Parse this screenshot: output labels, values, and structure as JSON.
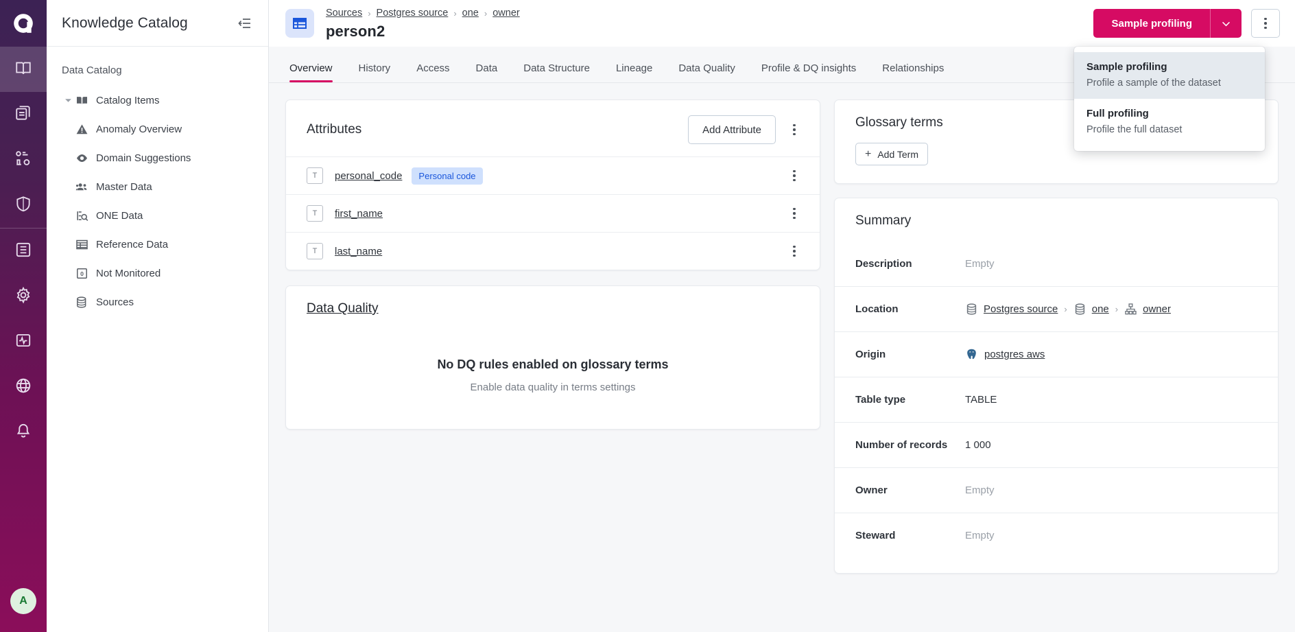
{
  "brand": {
    "logo_alt": "ataccama-logo",
    "accent": "#d60b63",
    "rail_gradient_top": "#3c2254",
    "rail_gradient_bottom": "#8b0e5a"
  },
  "rail": {
    "items": [
      {
        "name": "knowledge-catalog",
        "icon": "book-icon",
        "active": true
      },
      {
        "name": "files",
        "icon": "documents-icon",
        "active": false
      },
      {
        "name": "data-observability",
        "icon": "metrics-icon",
        "active": false
      },
      {
        "name": "data-privacy",
        "icon": "shield-icon",
        "active": false
      },
      {
        "name": "tasks",
        "icon": "list-icon",
        "active": false
      },
      {
        "name": "settings",
        "icon": "gear-icon",
        "active": false
      },
      {
        "name": "monitoring",
        "icon": "pulse-icon",
        "active": false
      },
      {
        "name": "global",
        "icon": "globe-icon",
        "active": false
      },
      {
        "name": "notifications",
        "icon": "bell-icon",
        "active": false
      }
    ],
    "avatar_initial": "A"
  },
  "sidebar": {
    "title": "Knowledge Catalog",
    "collapse_icon": "collapse-panel-icon",
    "section_label": "Data Catalog",
    "tree": [
      {
        "label": "Catalog Items",
        "icon": "book-icon",
        "level": 1,
        "expanded": true
      },
      {
        "label": "Anomaly Overview",
        "icon": "warning-triangle-icon",
        "level": 2
      },
      {
        "label": "Domain Suggestions",
        "icon": "eye-icon",
        "level": 2
      },
      {
        "label": "Master Data",
        "icon": "people-icon",
        "level": 2
      },
      {
        "label": "ONE Data",
        "icon": "search-data-icon",
        "level": 2
      },
      {
        "label": "Reference Data",
        "icon": "table-icon",
        "level": 2
      },
      {
        "label": "Not Monitored",
        "icon": "zero-box-icon",
        "level": 2
      },
      {
        "label": "Sources",
        "icon": "database-icon",
        "level": 1
      }
    ]
  },
  "header": {
    "entity_icon": "table-icon",
    "breadcrumbs": [
      "Sources",
      "Postgres source",
      "one",
      "owner"
    ],
    "breadcrumb_separator": "›",
    "title": "person2",
    "primary_button": "Sample profiling",
    "caret_icon": "chevron-down-icon",
    "kebab_icon": "more-vertical-icon"
  },
  "dropdown": {
    "items": [
      {
        "title": "Sample profiling",
        "desc": "Profile a sample of the dataset",
        "hovered": true
      },
      {
        "title": "Full profiling",
        "desc": "Profile the full dataset",
        "hovered": false
      }
    ]
  },
  "tabs": [
    {
      "label": "Overview",
      "active": true
    },
    {
      "label": "History",
      "active": false
    },
    {
      "label": "Access",
      "active": false
    },
    {
      "label": "Data",
      "active": false
    },
    {
      "label": "Data Structure",
      "active": false
    },
    {
      "label": "Lineage",
      "active": false
    },
    {
      "label": "Data Quality",
      "active": false
    },
    {
      "label": "Profile & DQ insights",
      "active": false
    },
    {
      "label": "Relationships",
      "active": false
    }
  ],
  "attributes_card": {
    "title": "Attributes",
    "add_button": "Add Attribute",
    "kebab_icon": "more-vertical-icon",
    "rows": [
      {
        "type_glyph": "T",
        "name": "personal_code",
        "badge": "Personal code"
      },
      {
        "type_glyph": "T",
        "name": "first_name",
        "badge": ""
      },
      {
        "type_glyph": "T",
        "name": "last_name",
        "badge": ""
      }
    ]
  },
  "data_quality_card": {
    "title": "Data Quality",
    "empty_title": "No DQ rules enabled on glossary terms",
    "empty_sub": "Enable data quality in terms settings"
  },
  "glossary_card": {
    "title": "Glossary terms",
    "add_term_label": "Add Term",
    "plus_glyph": "+"
  },
  "summary_card": {
    "title": "Summary",
    "rows": [
      {
        "label": "Description",
        "value": "Empty",
        "empty": true,
        "kind": "text"
      },
      {
        "label": "Location",
        "value": "",
        "empty": false,
        "kind": "location",
        "parts": [
          {
            "icon": "database-icon",
            "text": "Postgres source"
          },
          {
            "icon": "database-icon",
            "text": "one"
          },
          {
            "icon": "schema-icon",
            "text": "owner"
          }
        ]
      },
      {
        "label": "Origin",
        "value": "postgres aws",
        "empty": false,
        "kind": "origin",
        "icon": "postgres-elephant-icon"
      },
      {
        "label": "Table type",
        "value": "TABLE",
        "empty": false,
        "kind": "text"
      },
      {
        "label": "Number of records",
        "value": "1 000",
        "empty": false,
        "kind": "text"
      },
      {
        "label": "Owner",
        "value": "Empty",
        "empty": true,
        "kind": "text"
      },
      {
        "label": "Steward",
        "value": "Empty",
        "empty": true,
        "kind": "text"
      }
    ]
  }
}
